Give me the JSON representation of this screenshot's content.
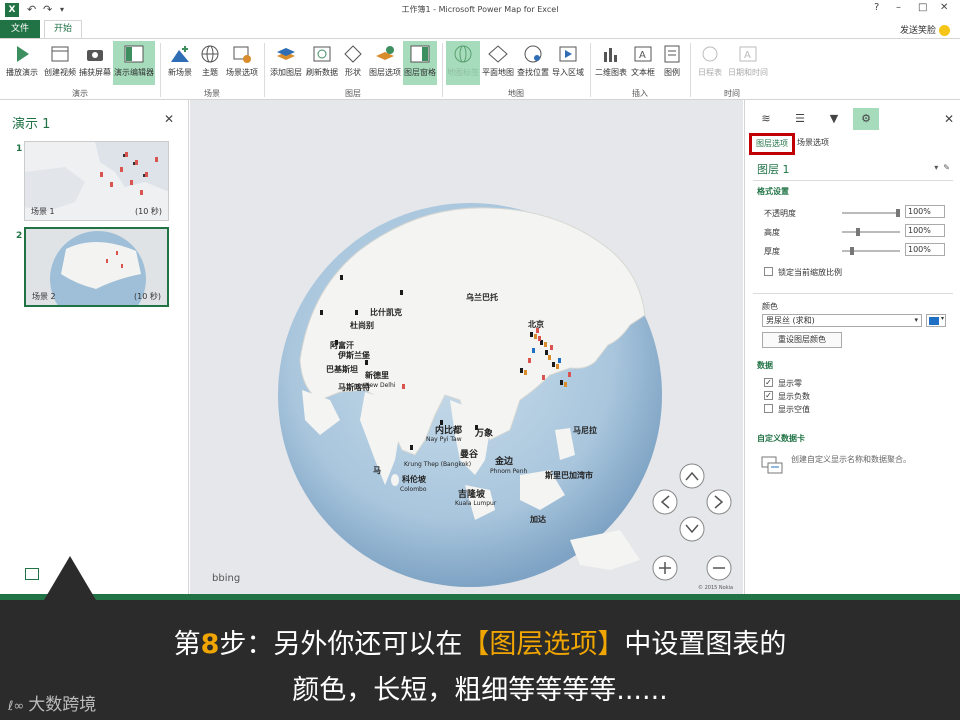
{
  "titlebar": {
    "app_icon": "X",
    "title": "工作簿1 - Microsoft Power Map for Excel",
    "help": "?",
    "minimize": "–",
    "restore": "□",
    "close": "✕"
  },
  "tabs": {
    "file": "文件",
    "home": "开始",
    "user": "发送笑脸"
  },
  "ribbon": {
    "play_tour": "播放演示",
    "create_video": "创建视频",
    "capture_screen": "捕获屏幕",
    "tour_editor": "演示编辑器",
    "new_scene": "新场景",
    "theme": "主题",
    "scene_options": "场景选项",
    "add_layer": "添加图层",
    "refresh_data": "刷新数据",
    "shapes": "形状",
    "layer_options": "图层选项",
    "layer_pane": "图层窗格",
    "map_labels": "地图标签",
    "flat_map": "平面地图",
    "find_location": "查找位置",
    "import_region": "导入区域",
    "2d_chart": "二维图表",
    "text_box": "文本框",
    "legend": "图例",
    "timeline": "日程表",
    "date_time": "日期和时间",
    "groups": {
      "tour": "演示",
      "scene": "场景",
      "layer": "图层",
      "map": "地图",
      "insert": "插入",
      "time": "时间"
    }
  },
  "left_panel": {
    "title": "演示 1",
    "close": "✕",
    "scenes": [
      {
        "num": "1",
        "name": "场景 1",
        "duration": "(10 秒)"
      },
      {
        "num": "2",
        "name": "场景 2",
        "duration": "(10 秒)"
      }
    ]
  },
  "map": {
    "bing": "bing",
    "copyright": "© 2015 Nokia",
    "labels": [
      "乌兰巴托",
      "北京",
      "比什凯克",
      "杜尚别",
      "阿富汗",
      "伊斯兰堡",
      "巴基斯坦",
      "新德里",
      "New Delhi",
      "马斯喀特",
      "内比都",
      "Nay Pyi Taw",
      "万象",
      "曼谷",
      "Krung Thep (Bangkok)",
      "金边",
      "Phnom Penh",
      "马尼拉",
      "马",
      "科伦坡",
      "Colombo",
      "吉隆坡",
      "Kuala Lumpur",
      "斯里巴加湾市",
      "加达"
    ]
  },
  "right_panel": {
    "subtab_layer": "图层选项",
    "subtab_scene": "场景选项",
    "layer_name": "图层 1",
    "format_section": "格式设置",
    "opacity_label": "不透明度",
    "opacity_value": "100%",
    "opacity_level": 1.0,
    "height_label": "高度",
    "height_value": "100%",
    "height_level": 0.25,
    "thickness_label": "厚度",
    "thickness_value": "100%",
    "thickness_level": 0.15,
    "lock_scale": "锁定当前缩放比例",
    "color_section": "颜色",
    "color_select": "男尿丝 (求和)",
    "color_swatch": "#1f6fc5",
    "reset_color": "重设图层颜色",
    "data_section": "数据",
    "show_zero": "显示零",
    "show_negative": "显示负数",
    "show_empty": "显示空值",
    "custom_card_section": "自定义数据卡",
    "custom_card_tip": "创建自定义显示名称和数据聚合。"
  },
  "caption": {
    "line1_a": "第",
    "line1_num": "8",
    "line1_b": "步：另外你还可以在",
    "line1_hl": "【图层选项】",
    "line1_c": "中设置图表的",
    "line2": "颜色，长短，粗细等等等等......"
  },
  "logo": {
    "mark": "ℓ∞",
    "text": "大数跨境"
  }
}
